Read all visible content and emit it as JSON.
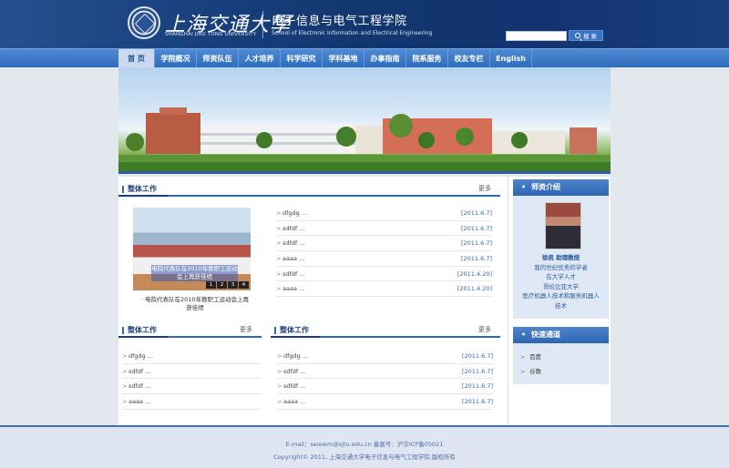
{
  "header": {
    "university_cn": "上海交通大學",
    "university_en": "SHANGHAI JIAO TONG UNIVERSITY",
    "school_cn": "电子信息与电气工程学院",
    "school_en": "School of Electronic Information and Electrical Engineering",
    "search_button": "搜 索",
    "search_value": ""
  },
  "nav": {
    "items": [
      {
        "label": "首 页",
        "active": true
      },
      {
        "label": "学院概况"
      },
      {
        "label": "师资队伍"
      },
      {
        "label": "人才培养"
      },
      {
        "label": "科学研究"
      },
      {
        "label": "学科基地"
      },
      {
        "label": "办事指南"
      },
      {
        "label": "院系服务"
      },
      {
        "label": "校友专栏"
      },
      {
        "label": "English"
      }
    ]
  },
  "sections": {
    "top": {
      "title": "整体工作",
      "more": "更多",
      "photo_caption": "电院代表队在2010年教职工运动会上再获佳绩",
      "photo_pager": [
        "1",
        "2",
        "3",
        "4"
      ],
      "photo_text": "· 电院代表队在2010年教职工运动会上再获佳绩",
      "items": [
        {
          "title": "dfgdg ...",
          "date": "[2011.6.7]"
        },
        {
          "title": "sdfdf ...",
          "date": "[2011.6.7]"
        },
        {
          "title": "sdfdf ...",
          "date": "[2011.6.7]"
        },
        {
          "title": "aaaa ...",
          "date": "[2011.6.7]"
        },
        {
          "title": "sdfdf ...",
          "date": "[2011.4.20]"
        },
        {
          "title": "aaaa ...",
          "date": "[2011.4.20]"
        }
      ]
    },
    "bottom_left": {
      "title": "整体工作",
      "more": "更多",
      "items": [
        {
          "title": "dfgdg ..."
        },
        {
          "title": "sdfdf ..."
        },
        {
          "title": "sdfdf ..."
        },
        {
          "title": "aaaa ..."
        }
      ]
    },
    "bottom_right": {
      "title": "整体工作",
      "more": "更多",
      "items": [
        {
          "title": "dfgdg ...",
          "date": "[2011.6.7]"
        },
        {
          "title": "sdfdf ...",
          "date": "[2011.6.7]"
        },
        {
          "title": "sdfdf ...",
          "date": "[2011.6.7]"
        },
        {
          "title": "aaaa ...",
          "date": "[2011.6.7]"
        }
      ]
    }
  },
  "sidebar": {
    "teachers": {
      "title": "师资介绍",
      "name": "徐凯 助理教授",
      "lines": [
        "我的世纪优秀的学者",
        "在大学人才",
        "哥伦比亚大学",
        "医疗机器人技术和服务机器人",
        "技术"
      ]
    },
    "quick": {
      "title": "快速通道",
      "items": [
        "百度",
        "谷歌"
      ]
    }
  },
  "footer": {
    "contact": "E-mail：seiewm@sjtu.edu.cn 备案号：沪交ICP备05021",
    "copyright": "Copyright© 2011, 上海交通大学电子信息与电气工程学院 版权所有"
  },
  "colors": {
    "primary": "#2d65b3",
    "nav": "#3a76c6",
    "date": "#3066b4"
  }
}
